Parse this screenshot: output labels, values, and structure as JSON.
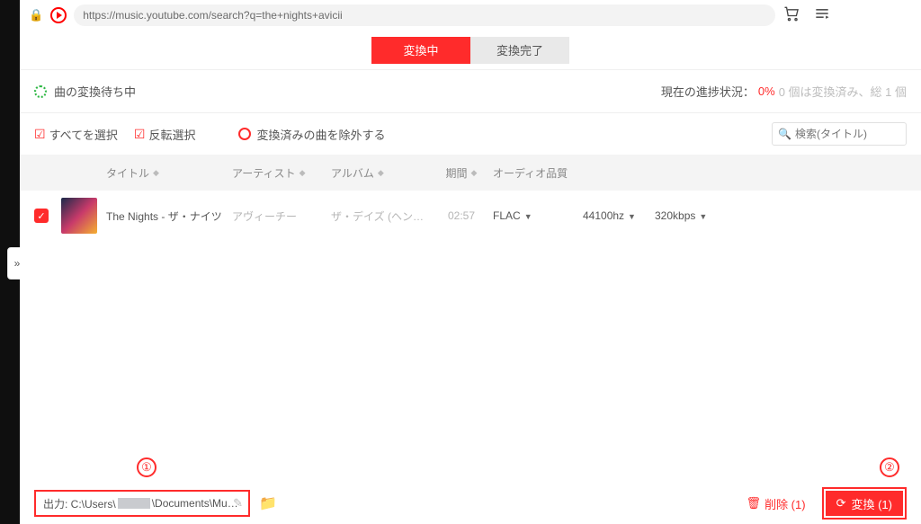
{
  "address": {
    "url": "https://music.youtube.com/search?q=the+nights+avicii"
  },
  "tabs": {
    "converting": "変換中",
    "done": "変換完了"
  },
  "status": {
    "label": "曲の変換待ち中",
    "progress_label": "現在の進捗状況：",
    "progress_value": "0%",
    "summary": "0 個は変換済み、総 1 個"
  },
  "controls": {
    "select_all": "すべてを選択",
    "invert": "反転選択",
    "exclude_converted": "変換済みの曲を除外する",
    "search_placeholder": "検索(タイトル)"
  },
  "columns": {
    "title": "タイトル",
    "artist": "アーティスト",
    "album": "アルバム",
    "duration": "期間",
    "quality": "オーディオ品質"
  },
  "rows": [
    {
      "title": "The Nights - ザ・ナイツ",
      "artist": "アヴィーチー",
      "album": "ザ・デイズ (ヘン…",
      "duration": "02:57",
      "format": "FLAC",
      "hz": "44100hz",
      "kbps": "320kbps"
    }
  ],
  "bottom": {
    "output_label": "出力: C:\\Users\\",
    "output_suffix": "\\Documents\\Mu…",
    "delete_label": "削除 (1)",
    "convert_label": "変換 (1)"
  },
  "annotations": {
    "one": "①",
    "two": "②"
  }
}
